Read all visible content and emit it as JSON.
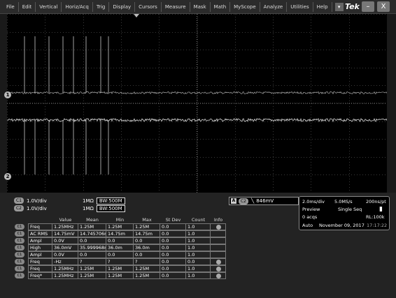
{
  "menu": {
    "items": [
      "File",
      "Edit",
      "Vertical",
      "Horiz/Acq",
      "Trig",
      "Display",
      "Cursors",
      "Measure",
      "Mask",
      "Math",
      "MyScope",
      "Analyze",
      "Utilities",
      "Help"
    ],
    "dropdown_glyph": "▾"
  },
  "brand": "Tek",
  "window": {
    "minimize": "–",
    "close": "X"
  },
  "markers": {
    "ch1": "1",
    "ch2": "2"
  },
  "channels": [
    {
      "badge": "C1",
      "scale": "1.0V/div",
      "impedance": "1MΩ",
      "bandwidth": "BW:500M"
    },
    {
      "badge": "C2",
      "scale": "1.0V/div",
      "impedance": "1MΩ",
      "bandwidth": "BW:500M"
    }
  ],
  "trigger": {
    "mode": "A",
    "source": "C2",
    "slope": "╲",
    "level": "846mV"
  },
  "acquisition": {
    "timebase": "2.0ms/div",
    "sample_rate": "5.0MS/s",
    "resolution": "200ns/pt",
    "mode": "Preview",
    "seq": "Single Seq",
    "acqs": "0 acqs",
    "record_length": "RL:100k",
    "auto": "Auto",
    "date": "November 09, 2017",
    "time": "17:17:22"
  },
  "measurements": {
    "headers": [
      "Value",
      "Mean",
      "Min",
      "Max",
      "St Dev",
      "Count",
      "Info"
    ],
    "rows": [
      {
        "src": "C1",
        "name": "Freq",
        "value": "1.25MHz",
        "mean": "1.25M",
        "min": "1.25M",
        "max": "1.25M",
        "sd": "0.0",
        "count": "1.0",
        "info": true
      },
      {
        "src": "C1",
        "name": "AC RMS",
        "value": "14.75mV",
        "mean": "14.745706m",
        "min": "14.75m",
        "max": "14.75m",
        "sd": "0.0",
        "count": "1.0",
        "info": false
      },
      {
        "src": "C1",
        "name": "Ampl",
        "value": "0.0V",
        "mean": "0.0",
        "min": "0.0",
        "max": "0.0",
        "sd": "0.0",
        "count": "1.0",
        "info": false
      },
      {
        "src": "C1",
        "name": "High",
        "value": "36.0mV",
        "mean": "35.999968m",
        "min": "36.0m",
        "max": "36.0m",
        "sd": "0.0",
        "count": "1.0",
        "info": false
      },
      {
        "src": "C1",
        "name": "Ampl",
        "value": "0.0V",
        "mean": "0.0",
        "min": "0.0",
        "max": "0.0",
        "sd": "0.0",
        "count": "1.0",
        "info": false
      },
      {
        "src": "C1",
        "name": "Freq",
        "value": "-Hz",
        "mean": "?",
        "min": "?",
        "max": "?",
        "sd": "0.0",
        "count": "0.0",
        "info": true
      },
      {
        "src": "C1",
        "name": "Freq",
        "value": "1.25MHz",
        "mean": "1.25M",
        "min": "1.25M",
        "max": "1.25M",
        "sd": "0.0",
        "count": "1.0",
        "info": true
      },
      {
        "src": "C1",
        "name": "Freq*",
        "value": "1.25MHz",
        "mean": "1.25M",
        "min": "1.25M",
        "max": "1.25M",
        "sd": "0.0",
        "count": "1.0",
        "info": true
      }
    ]
  },
  "colors": {
    "background": "#000000",
    "grid": "#3a3a3a",
    "trace": "#e6e6e6",
    "panel": "#232323"
  }
}
